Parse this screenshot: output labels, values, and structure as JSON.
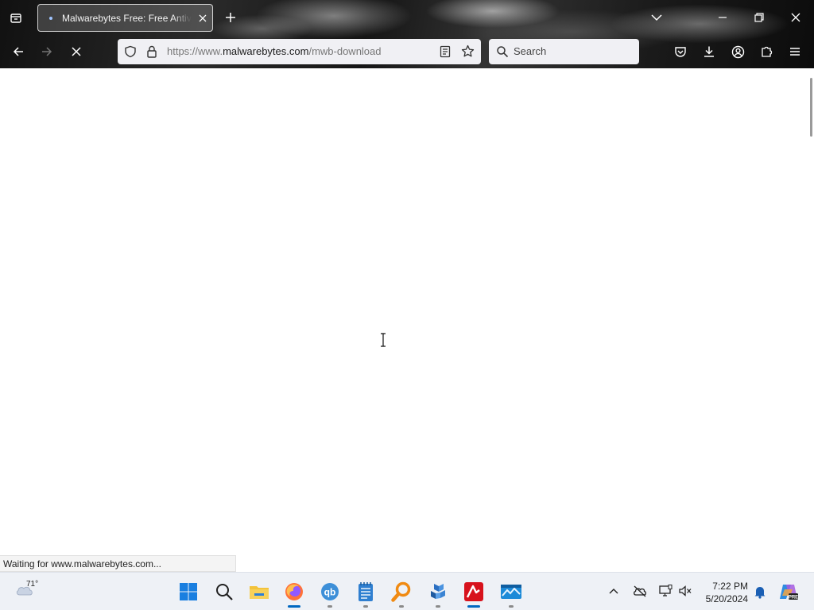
{
  "browser": {
    "tab_title": "Malwarebytes Free: Free Antivirus",
    "url_prefix": "https://www.",
    "url_domain": "malwarebytes.com",
    "url_path": "/mwb-download",
    "search_placeholder": "Search",
    "accent": "#0067c0"
  },
  "page": {
    "status_text": "Waiting for www.malwarebytes.com..."
  },
  "taskbar": {
    "weather_temp": "71°",
    "time": "7:22 PM",
    "date": "5/20/2024",
    "apps": [
      "windows-start",
      "search",
      "file-explorer",
      "firefox",
      "qbittorrent",
      "notepad",
      "search-tool",
      "app-blue",
      "avira",
      "photos"
    ]
  }
}
